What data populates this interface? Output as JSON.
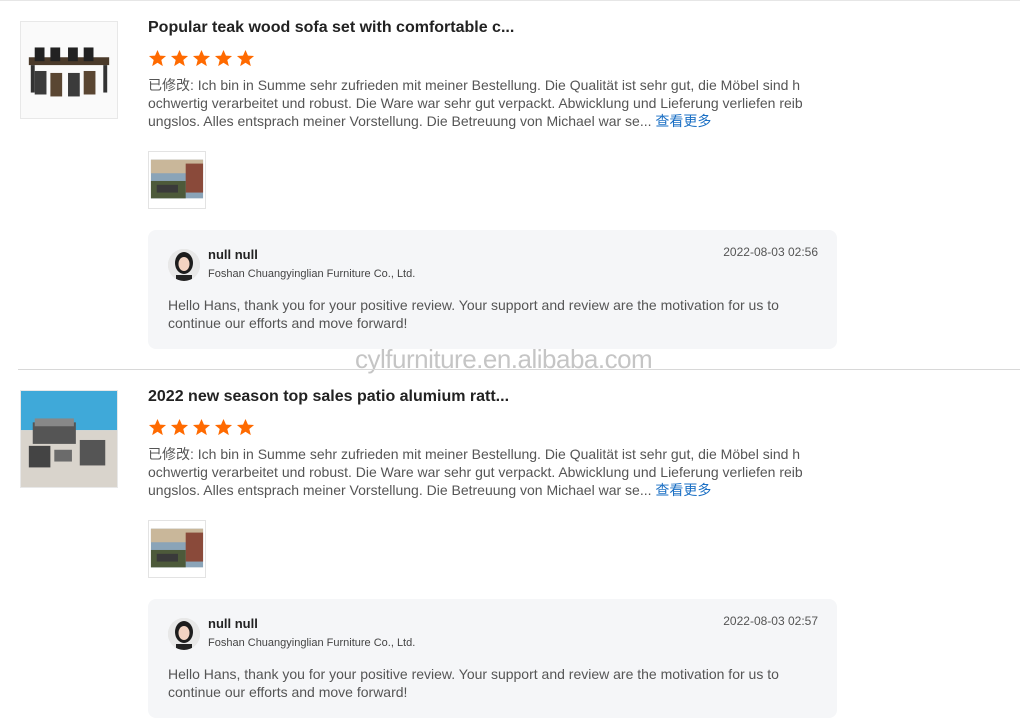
{
  "reviews": [
    {
      "title": "Popular teak wood sofa set with comfortable c...",
      "rating": 5,
      "body": "已修改: Ich bin in Summe sehr zufrieden mit meiner Bestellung. Die Qualität ist sehr gut, die Möbel sind hochwertig verarbeitet und robust. Die Ware war sehr gut verpackt. Abwicklung und Lieferung verliefen reibungslos. Alles entsprach meiner Vorstellung. Die Betreuung von Michael war se...",
      "more_label": "查看更多",
      "reply": {
        "name": "null null",
        "company": "Foshan Chuangyinglian Furniture Co., Ltd.",
        "date": "2022-08-03 02:56",
        "text": "Hello Hans, thank you for your positive review. Your support and review are the motivation for us to continue our efforts and move forward!"
      }
    },
    {
      "title": "2022 new season top sales patio alumium ratt...",
      "rating": 5,
      "body": "已修改: Ich bin in Summe sehr zufrieden mit meiner Bestellung. Die Qualität ist sehr gut, die Möbel sind hochwertig verarbeitet und robust. Die Ware war sehr gut verpackt. Abwicklung und Lieferung verliefen reibungslos. Alles entsprach meiner Vorstellung. Die Betreuung von Michael war se...",
      "more_label": "查看更多",
      "reply": {
        "name": "null null",
        "company": "Foshan Chuangyinglian Furniture Co., Ltd.",
        "date": "2022-08-03 02:57",
        "text": "Hello Hans, thank you for your positive review. Your support and review are the motivation for us to continue our efforts and move forward!"
      }
    }
  ],
  "watermark": "cylfurniture.en.alibaba.com",
  "colors": {
    "star": "#ff6a00",
    "link": "#1a6fc4",
    "reply_bg": "#f5f6f8"
  },
  "icons": {
    "rating": "star-icon"
  }
}
